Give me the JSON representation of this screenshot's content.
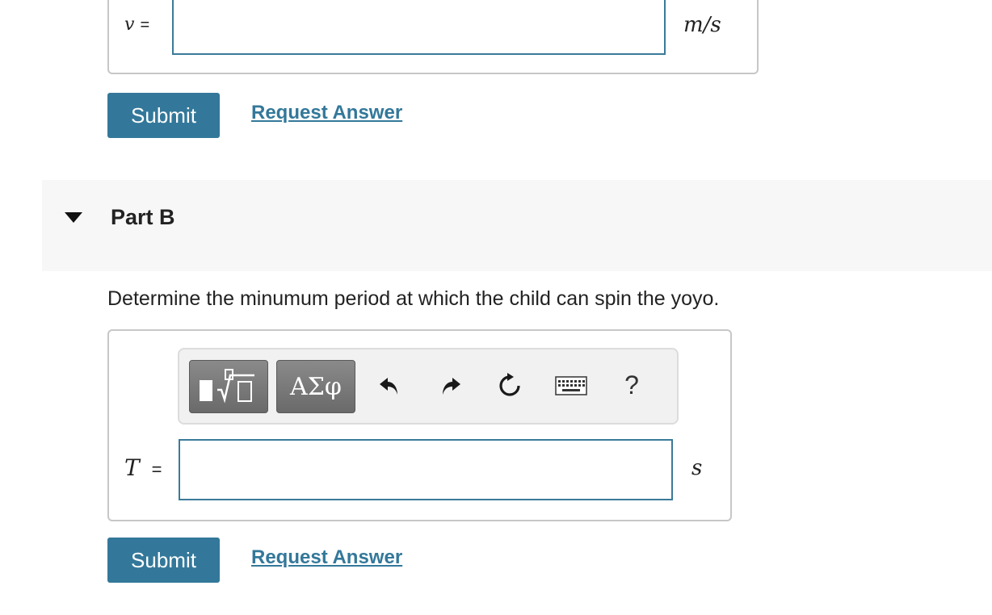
{
  "part_a": {
    "variable": "v",
    "equals": "=",
    "unit": "m/s",
    "submit_label": "Submit",
    "request_label": "Request Answer"
  },
  "part_b": {
    "title": "Part B",
    "question": "Determine the minumum period at which the child can spin the yoyo.",
    "toolbar": {
      "symbols_label": "ΑΣφ",
      "help_label": "?"
    },
    "variable": "T",
    "equals": "=",
    "unit": "s",
    "submit_label": "Submit",
    "request_label": "Request Answer"
  },
  "colors": {
    "accent": "#33789a",
    "input_border": "#3a7a99",
    "header_bg": "#f7f7f7"
  }
}
